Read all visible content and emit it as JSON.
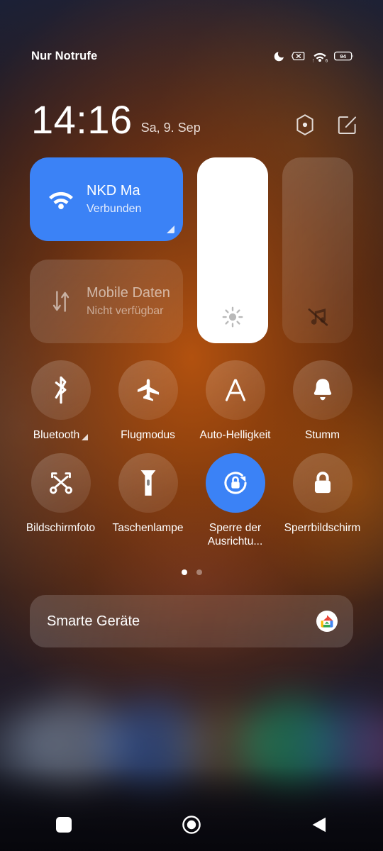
{
  "colors": {
    "accent_blue": "#3b82f6",
    "tile_inactive": "rgba(255,255,255,0.13)",
    "text_primary": "#ffffff",
    "slider_fill": "#ffffff"
  },
  "statusbar": {
    "carrier": "Nur Notrufe",
    "icons": [
      {
        "name": "do-not-disturb-icon",
        "glyph": "moon"
      },
      {
        "name": "sim-disabled-icon",
        "glyph": "signal-x"
      },
      {
        "name": "wifi-icon",
        "glyph": "wifi",
        "badge": "6"
      },
      {
        "name": "battery-icon",
        "glyph": "battery",
        "level": "94"
      }
    ],
    "battery_level": "94",
    "wifi_generation": "6"
  },
  "header": {
    "clock": "14:16",
    "date": "Sa, 9. Sep",
    "actions": [
      {
        "name": "settings-button",
        "icon": "hexagon-gear-icon"
      },
      {
        "name": "edit-tiles-button",
        "icon": "edit-pencil-icon"
      }
    ]
  },
  "tiles": {
    "wifi": {
      "title": "NKD                Ma",
      "subtitle": "Verbunden",
      "state": "active",
      "icon": "wifi-icon",
      "has_expand_corner": true
    },
    "mobile_data": {
      "title": "Mobile Daten",
      "subtitle": "Nicht verfügbar",
      "state": "inactive",
      "icon": "mobile-data-arrows-icon",
      "has_expand_corner": false
    },
    "brightness_slider": {
      "name": "brightness-slider",
      "icon": "sun-icon",
      "value": 100,
      "min": 0,
      "max": 100
    },
    "volume_slider": {
      "name": "volume-slider",
      "icon": "music-note-muted-icon",
      "value": 0,
      "min": 0,
      "max": 100
    }
  },
  "toggles": [
    {
      "label": "Bluetooth",
      "icon": "bluetooth-icon",
      "state": "off",
      "expandable": true
    },
    {
      "label": "Flugmodus",
      "icon": "airplane-icon",
      "state": "off",
      "expandable": false
    },
    {
      "label": "Auto-Helligkeit",
      "icon": "auto-brightness-a-icon",
      "state": "off",
      "expandable": false
    },
    {
      "label": "Stumm",
      "icon": "bell-icon",
      "state": "off",
      "expandable": false
    },
    {
      "label": "Bildschirmfoto",
      "icon": "screenshot-scissors-icon",
      "state": "off",
      "expandable": false
    },
    {
      "label": "Taschenlampe",
      "icon": "flashlight-icon",
      "state": "off",
      "expandable": false
    },
    {
      "label": "Sperre der Ausrichtu...",
      "icon": "rotation-lock-icon",
      "state": "on",
      "expandable": false
    },
    {
      "label": "Sperrbildschirm",
      "icon": "lock-icon",
      "state": "off",
      "expandable": false
    }
  ],
  "pager": {
    "pages": 2,
    "active_index": 0
  },
  "smart_devices": {
    "label": "Smarte Geräte",
    "icon": "google-home-icon"
  },
  "navbar": [
    {
      "name": "nav-recents-button",
      "icon": "square-icon"
    },
    {
      "name": "nav-home-button",
      "icon": "circle-icon"
    },
    {
      "name": "nav-back-button",
      "icon": "triangle-left-icon"
    }
  ]
}
